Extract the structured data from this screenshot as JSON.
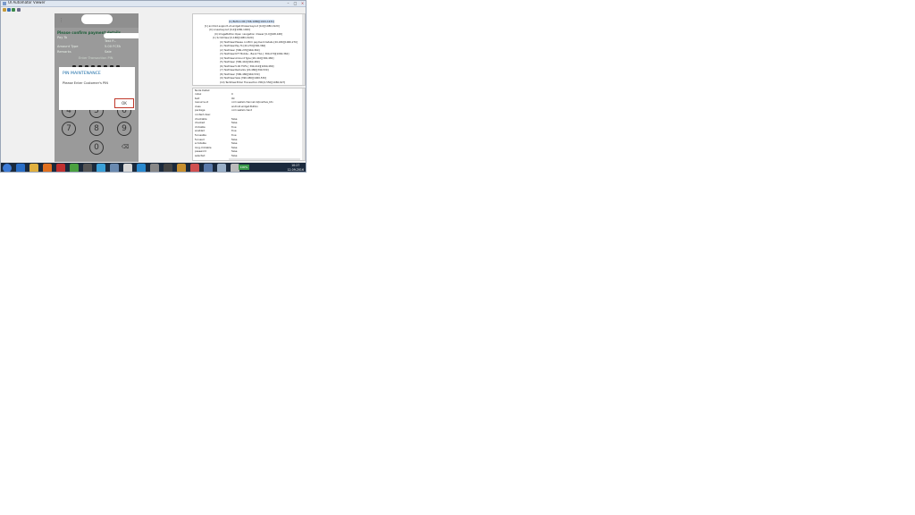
{
  "window": {
    "title": "UI Automator Viewer",
    "controls": [
      "–",
      "□",
      "×"
    ],
    "toolbar_icons": [
      "open-icon",
      "screenshot-icon",
      "device-screenshot-icon",
      "save-icon"
    ]
  },
  "phone": {
    "header_title": "Please confirm payment details",
    "rows": [
      {
        "label": "Pay To",
        "value": "Test P..."
      },
      {
        "label": "Amount Type",
        "value": "5.00 FCFA"
      },
      {
        "label": "Remarks",
        "value": "Sale"
      }
    ],
    "pin_label": "Enter Transaction PIN",
    "keypad": [
      "4",
      "5",
      "6",
      "7",
      "8",
      "9",
      "0",
      "⌫"
    ]
  },
  "dialog": {
    "title": "PIN MAINTENANCE",
    "message": "Please Enter Customer's PIN",
    "ok_label": "OK"
  },
  "tree": {
    "nodes": [
      "(1) Button:OK [796,1080][1021,1231]",
      "[1] android.support.v4.widget.DrawerLayout [0,0][1080,1920]",
      "(0) LinearLayout [0,0][1080,1920]",
      "(0) ImageButton:Open navigation drawer [0,0][168,168]",
      "(1) ScrollView [0,168][1080,1920]",
      "(0) TextView:Please confirm payment details [20,180][1060,270]",
      "(1) TextView:Pay To [20,270][390,360]",
      "(2) TextView: [580,270][960,360]",
      "(3) TextView:KYT Mobile - Bank TILL [ 390,270][1060,360]",
      "(4) TextView:Amount Type [20,410][390,480]",
      "(5) TextView: [580,410][960,480]",
      "(6) TextView:5.00 FCFA [ 390,410][1060,480]",
      "(7) TextView:Remarks [20,480][390,530]",
      "(8) TextView: [580,480][960,530]",
      "(9) TextView:Sale [390,480][1060,530]",
      "(10) TextView:Enter Transaction PIN [0,550][1080,627]"
    ]
  },
  "properties": {
    "header": "Node Detail",
    "rows": [
      {
        "key": "index",
        "value": "0"
      },
      {
        "key": "text",
        "value": "Ok"
      },
      {
        "key": "resource-id",
        "value": "com.wallet.channel:id/positive_btn"
      },
      {
        "key": "class",
        "value": "android.widget.Button"
      },
      {
        "key": "package",
        "value": "com.wallet.client"
      },
      {
        "key": "content-desc",
        "value": ""
      },
      {
        "key": "checkable",
        "value": "false"
      },
      {
        "key": "checked",
        "value": "false"
      },
      {
        "key": "clickable",
        "value": "true"
      },
      {
        "key": "enabled",
        "value": "true"
      },
      {
        "key": "focusable",
        "value": "true"
      },
      {
        "key": "focused",
        "value": "false"
      },
      {
        "key": "scrollable",
        "value": "false"
      },
      {
        "key": "long-clickable",
        "value": "false"
      },
      {
        "key": "password",
        "value": "false"
      },
      {
        "key": "selected",
        "value": "false"
      }
    ]
  },
  "taskbar": {
    "time": "10:27",
    "date": "12-09-2016",
    "active_label": "100%"
  }
}
